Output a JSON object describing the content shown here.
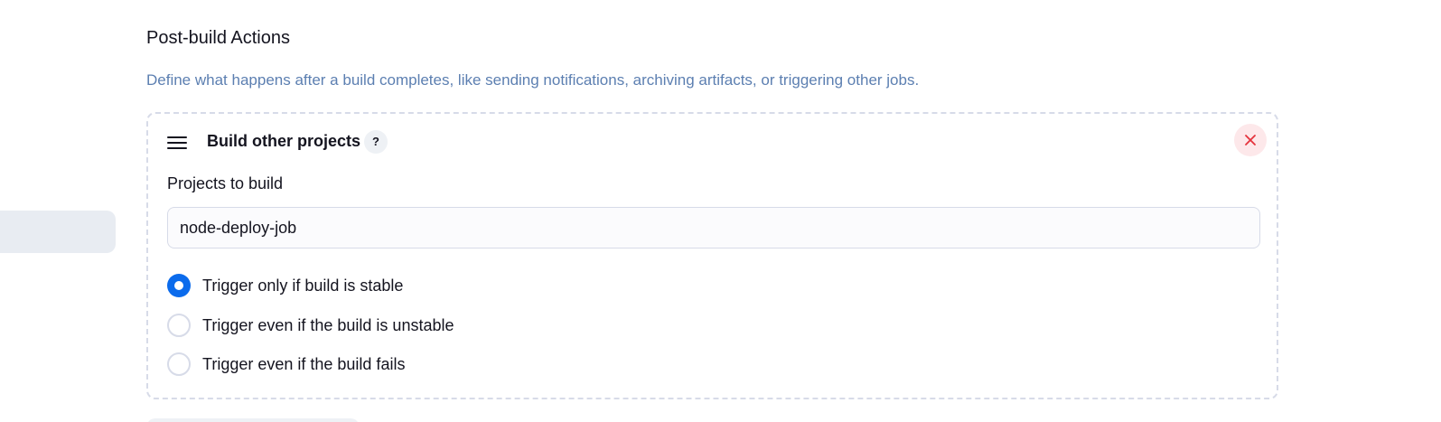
{
  "section": {
    "title": "Post-build Actions",
    "description": "Define what happens after a build completes, like sending notifications, archiving artifacts, or triggering other jobs."
  },
  "card": {
    "title": "Build other projects",
    "help_label": "?",
    "projects_label": "Projects to build",
    "projects_value": "node-deploy-job",
    "options": [
      {
        "label": "Trigger only if build is stable",
        "selected": true
      },
      {
        "label": "Trigger even if the build is unstable",
        "selected": false
      },
      {
        "label": "Trigger even if the build fails",
        "selected": false
      }
    ]
  },
  "colors": {
    "accent": "#0b6bec",
    "close": "#e5323c",
    "description": "#5c7fb1"
  },
  "icons": {
    "drag": "drag-handle-icon",
    "close": "close-icon",
    "help": "help-icon"
  }
}
